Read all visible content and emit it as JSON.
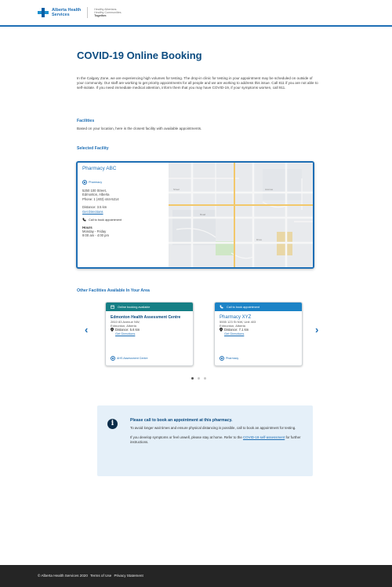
{
  "header": {
    "logo_text_line1": "Alberta Health",
    "logo_text_line2": "Services",
    "sub_line1": "Healthy Albertans.",
    "sub_line2": "Healthy Communities.",
    "sub_line3": "Together."
  },
  "page_title": "COVID-19 Online Booking",
  "intro": "In the Calgary Zone, we are experiencing high volumes for testing. The drop-in clinic for testing in your appointment may be scheduled on outside of your community. Our staff are working to get priority appointments for all people and we are working to address this issue. Call 811 if you are not able to self-isolate. If you need immediate medical attention, inform them that you may have COVID-19, if your symptoms worsen, call 911.",
  "facilities": {
    "heading": "Facilities",
    "text": "Based on your location, here is the closest facility with available appointments."
  },
  "selected": {
    "heading": "Selected Facility",
    "name": "Pharmacy ABC",
    "pill": "Pharmacy",
    "address1": "5250 100 Street,",
    "address2": "Edmonton, Alberta",
    "phone": "Phone: 1 (403) 444-5214",
    "distance": "Distance: 3.5 km",
    "directions": "Get Directions",
    "call_text": "Call to book appointment",
    "hours_title": "Hours",
    "hours_days": "Monday - Friday",
    "hours_time": "9:00 am - 4:00 pm"
  },
  "other": {
    "heading": "Other Facilities Available In Your Area",
    "prev_arrow": "‹",
    "next_arrow": "›",
    "cards": [
      {
        "band": "Online booking available",
        "name": "Edmonton Health Assessment Centre",
        "address1": "2810 83 Avenue NW,",
        "address2": "Edmonton, Alberta",
        "distance": "Distance: 5.6 km",
        "directions": "Get Directions",
        "foot": "AHS Assessment Centre"
      },
      {
        "band": "Call to book appointment",
        "name": "Pharmacy XYZ",
        "address1": "5555 123 St NW, Unit 403",
        "address2": "Edmonton, Alberta",
        "distance": "Distance: 7.1 km",
        "directions": "Get Directions",
        "foot": "Pharmacy"
      }
    ]
  },
  "notice": {
    "icon": "i",
    "title": "Please call to book an appointment at this pharmacy.",
    "text": "To avoid longer wait times and ensure physical distancing is possible, call to book an appointment for testing.",
    "text2_prefix": "If you develop symptoms or feel unwell, please stay at home. Refer to the",
    "text2_link": "COVID-19 self-assessment",
    "text2_suffix": "for further instructions."
  },
  "footer": {
    "copyright": "© Alberta Health Services 2020",
    "terms": "Terms of Use",
    "privacy": "Privacy Statement"
  },
  "colors": {
    "primary": "#1f6fb5",
    "teal_band": "#167f85",
    "blue_band": "#1c83c6",
    "notice_bg": "#e5f0f9",
    "footer_bg": "#252525"
  }
}
